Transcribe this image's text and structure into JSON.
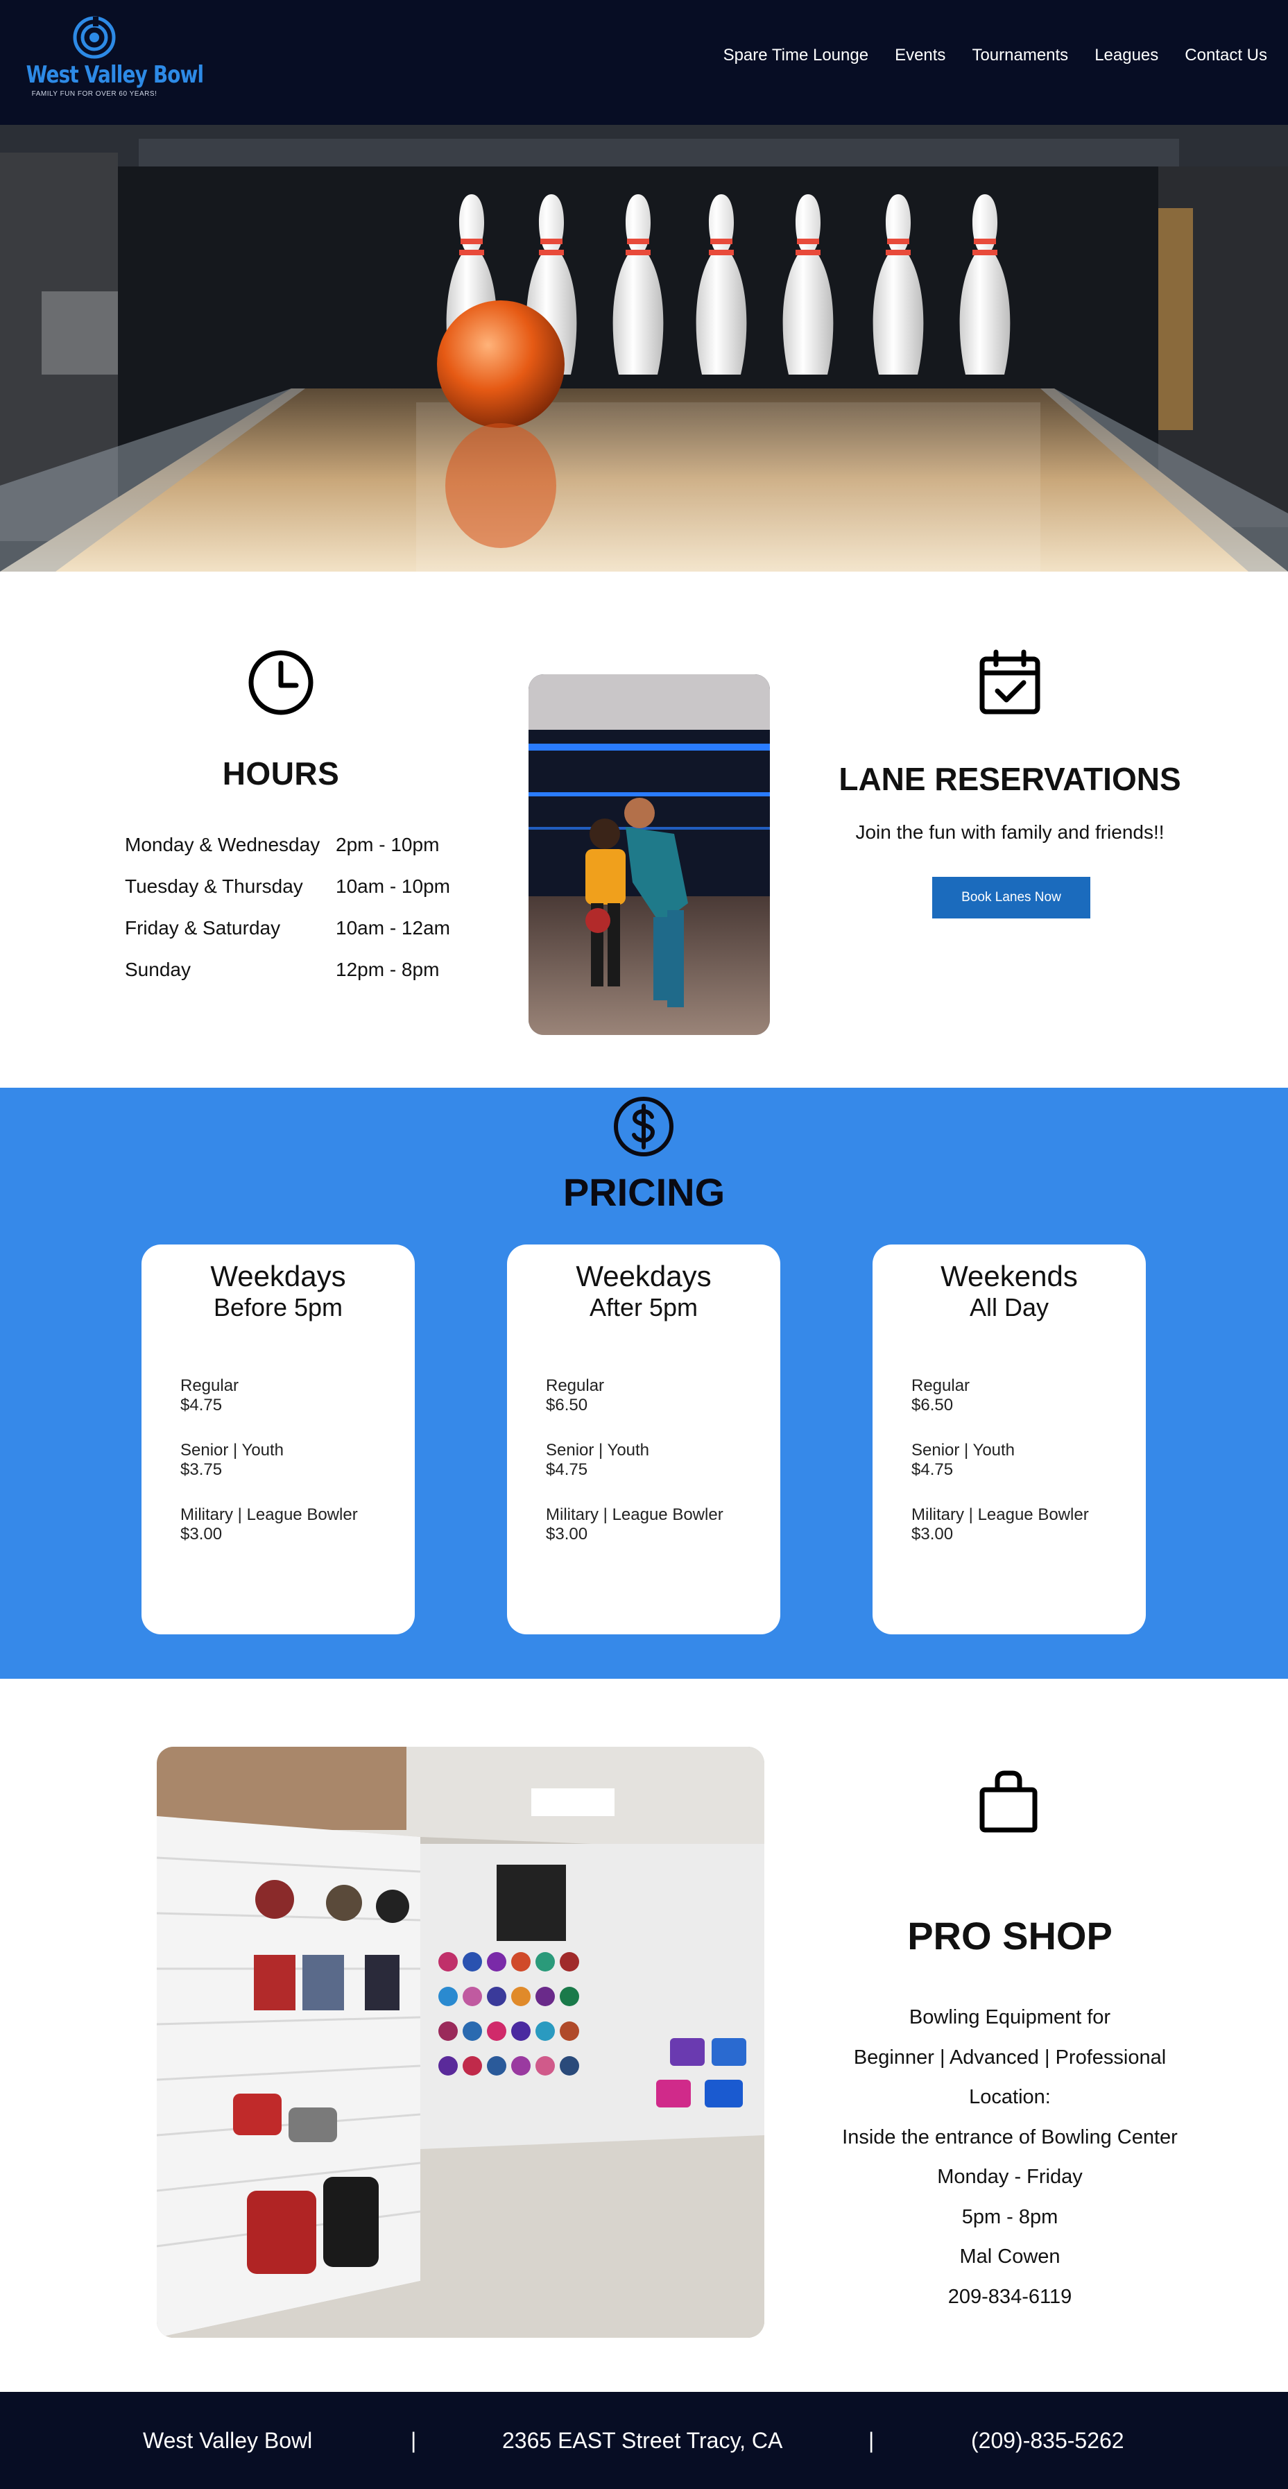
{
  "header": {
    "logo_title": "West Valley Bowl",
    "logo_tagline": "FAMILY FUN FOR OVER 60 YEARS!",
    "nav": [
      {
        "label": "Spare Time Lounge"
      },
      {
        "label": "Events"
      },
      {
        "label": "Tournaments"
      },
      {
        "label": "Leagues"
      },
      {
        "label": "Contact Us"
      }
    ]
  },
  "hours": {
    "title": "HOURS",
    "icon": "clock-icon",
    "rows": [
      {
        "day": "Monday & Wednesday",
        "time": "2pm - 10pm"
      },
      {
        "day": "Tuesday & Thursday",
        "time": "10am - 10pm"
      },
      {
        "day": "Friday & Saturday",
        "time": "10am - 12am"
      },
      {
        "day": "Sunday",
        "time": "12pm - 8pm"
      }
    ]
  },
  "reservations": {
    "title": "LANE RESERVATIONS",
    "icon": "calendar-check-icon",
    "subtitle": "Join the fun with family and friends!!",
    "button_label": "Book Lanes Now"
  },
  "pricing": {
    "title": "PRICING",
    "icon": "dollar-icon",
    "cards": [
      {
        "heading": "Weekdays",
        "subheading": "Before 5pm",
        "items": [
          {
            "label": "Regular",
            "price": "$4.75"
          },
          {
            "label": "Senior | Youth",
            "price": "$3.75"
          },
          {
            "label": "Military | League Bowler",
            "price": "$3.00"
          }
        ]
      },
      {
        "heading": "Weekdays",
        "subheading": "After 5pm",
        "items": [
          {
            "label": "Regular",
            "price": "$6.50"
          },
          {
            "label": "Senior | Youth",
            "price": "$4.75"
          },
          {
            "label": "Military | League Bowler",
            "price": "$3.00"
          }
        ]
      },
      {
        "heading": "Weekends",
        "subheading": "All Day",
        "items": [
          {
            "label": "Regular",
            "price": "$6.50"
          },
          {
            "label": "Senior | Youth",
            "price": "$4.75"
          },
          {
            "label": "Military | League Bowler",
            "price": "$3.00"
          }
        ]
      }
    ]
  },
  "proshop": {
    "title": "PRO SHOP",
    "icon": "shopping-bag-icon",
    "lines": [
      "Bowling Equipment for",
      "Beginner | Advanced | Professional",
      "Location:",
      "Inside the entrance of Bowling Center",
      "Monday - Friday",
      "5pm - 8pm",
      "Mal Cowen",
      "209-834-6119"
    ]
  },
  "footer": {
    "name": "West Valley Bowl",
    "separator": "|",
    "address": "2365 EAST Street Tracy, CA",
    "phone": "(209)-835-5262"
  },
  "colors": {
    "header_bg": "#070d24",
    "brand_blue": "#2d8ae6",
    "pricing_bg": "#3689e9",
    "button_bg": "#1b6bbd",
    "footer_bg": "#070d24"
  }
}
